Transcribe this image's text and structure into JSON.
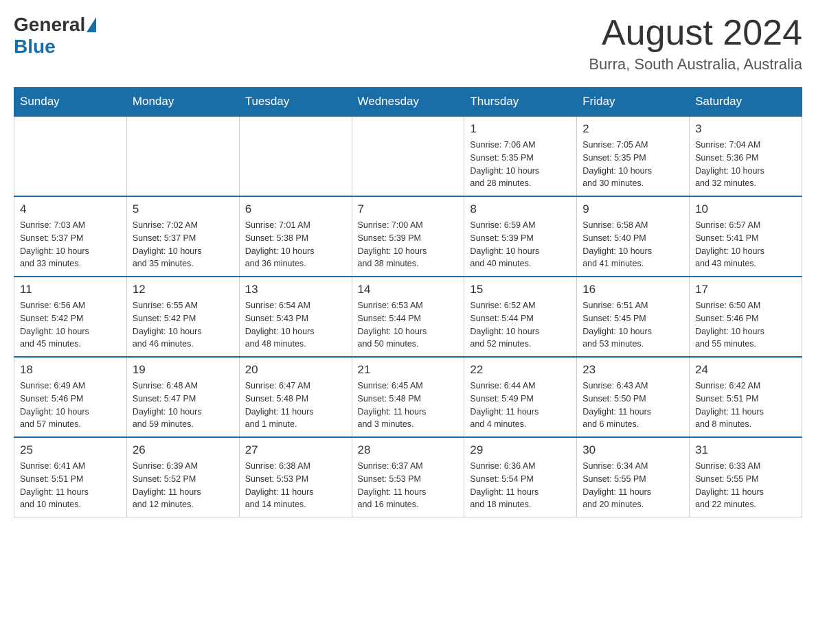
{
  "header": {
    "logo_general": "General",
    "logo_blue": "Blue",
    "month_year": "August 2024",
    "location": "Burra, South Australia, Australia"
  },
  "days_of_week": [
    "Sunday",
    "Monday",
    "Tuesday",
    "Wednesday",
    "Thursday",
    "Friday",
    "Saturday"
  ],
  "weeks": [
    [
      {
        "day": "",
        "info": ""
      },
      {
        "day": "",
        "info": ""
      },
      {
        "day": "",
        "info": ""
      },
      {
        "day": "",
        "info": ""
      },
      {
        "day": "1",
        "info": "Sunrise: 7:06 AM\nSunset: 5:35 PM\nDaylight: 10 hours\nand 28 minutes."
      },
      {
        "day": "2",
        "info": "Sunrise: 7:05 AM\nSunset: 5:35 PM\nDaylight: 10 hours\nand 30 minutes."
      },
      {
        "day": "3",
        "info": "Sunrise: 7:04 AM\nSunset: 5:36 PM\nDaylight: 10 hours\nand 32 minutes."
      }
    ],
    [
      {
        "day": "4",
        "info": "Sunrise: 7:03 AM\nSunset: 5:37 PM\nDaylight: 10 hours\nand 33 minutes."
      },
      {
        "day": "5",
        "info": "Sunrise: 7:02 AM\nSunset: 5:37 PM\nDaylight: 10 hours\nand 35 minutes."
      },
      {
        "day": "6",
        "info": "Sunrise: 7:01 AM\nSunset: 5:38 PM\nDaylight: 10 hours\nand 36 minutes."
      },
      {
        "day": "7",
        "info": "Sunrise: 7:00 AM\nSunset: 5:39 PM\nDaylight: 10 hours\nand 38 minutes."
      },
      {
        "day": "8",
        "info": "Sunrise: 6:59 AM\nSunset: 5:39 PM\nDaylight: 10 hours\nand 40 minutes."
      },
      {
        "day": "9",
        "info": "Sunrise: 6:58 AM\nSunset: 5:40 PM\nDaylight: 10 hours\nand 41 minutes."
      },
      {
        "day": "10",
        "info": "Sunrise: 6:57 AM\nSunset: 5:41 PM\nDaylight: 10 hours\nand 43 minutes."
      }
    ],
    [
      {
        "day": "11",
        "info": "Sunrise: 6:56 AM\nSunset: 5:42 PM\nDaylight: 10 hours\nand 45 minutes."
      },
      {
        "day": "12",
        "info": "Sunrise: 6:55 AM\nSunset: 5:42 PM\nDaylight: 10 hours\nand 46 minutes."
      },
      {
        "day": "13",
        "info": "Sunrise: 6:54 AM\nSunset: 5:43 PM\nDaylight: 10 hours\nand 48 minutes."
      },
      {
        "day": "14",
        "info": "Sunrise: 6:53 AM\nSunset: 5:44 PM\nDaylight: 10 hours\nand 50 minutes."
      },
      {
        "day": "15",
        "info": "Sunrise: 6:52 AM\nSunset: 5:44 PM\nDaylight: 10 hours\nand 52 minutes."
      },
      {
        "day": "16",
        "info": "Sunrise: 6:51 AM\nSunset: 5:45 PM\nDaylight: 10 hours\nand 53 minutes."
      },
      {
        "day": "17",
        "info": "Sunrise: 6:50 AM\nSunset: 5:46 PM\nDaylight: 10 hours\nand 55 minutes."
      }
    ],
    [
      {
        "day": "18",
        "info": "Sunrise: 6:49 AM\nSunset: 5:46 PM\nDaylight: 10 hours\nand 57 minutes."
      },
      {
        "day": "19",
        "info": "Sunrise: 6:48 AM\nSunset: 5:47 PM\nDaylight: 10 hours\nand 59 minutes."
      },
      {
        "day": "20",
        "info": "Sunrise: 6:47 AM\nSunset: 5:48 PM\nDaylight: 11 hours\nand 1 minute."
      },
      {
        "day": "21",
        "info": "Sunrise: 6:45 AM\nSunset: 5:48 PM\nDaylight: 11 hours\nand 3 minutes."
      },
      {
        "day": "22",
        "info": "Sunrise: 6:44 AM\nSunset: 5:49 PM\nDaylight: 11 hours\nand 4 minutes."
      },
      {
        "day": "23",
        "info": "Sunrise: 6:43 AM\nSunset: 5:50 PM\nDaylight: 11 hours\nand 6 minutes."
      },
      {
        "day": "24",
        "info": "Sunrise: 6:42 AM\nSunset: 5:51 PM\nDaylight: 11 hours\nand 8 minutes."
      }
    ],
    [
      {
        "day": "25",
        "info": "Sunrise: 6:41 AM\nSunset: 5:51 PM\nDaylight: 11 hours\nand 10 minutes."
      },
      {
        "day": "26",
        "info": "Sunrise: 6:39 AM\nSunset: 5:52 PM\nDaylight: 11 hours\nand 12 minutes."
      },
      {
        "day": "27",
        "info": "Sunrise: 6:38 AM\nSunset: 5:53 PM\nDaylight: 11 hours\nand 14 minutes."
      },
      {
        "day": "28",
        "info": "Sunrise: 6:37 AM\nSunset: 5:53 PM\nDaylight: 11 hours\nand 16 minutes."
      },
      {
        "day": "29",
        "info": "Sunrise: 6:36 AM\nSunset: 5:54 PM\nDaylight: 11 hours\nand 18 minutes."
      },
      {
        "day": "30",
        "info": "Sunrise: 6:34 AM\nSunset: 5:55 PM\nDaylight: 11 hours\nand 20 minutes."
      },
      {
        "day": "31",
        "info": "Sunrise: 6:33 AM\nSunset: 5:55 PM\nDaylight: 11 hours\nand 22 minutes."
      }
    ]
  ]
}
